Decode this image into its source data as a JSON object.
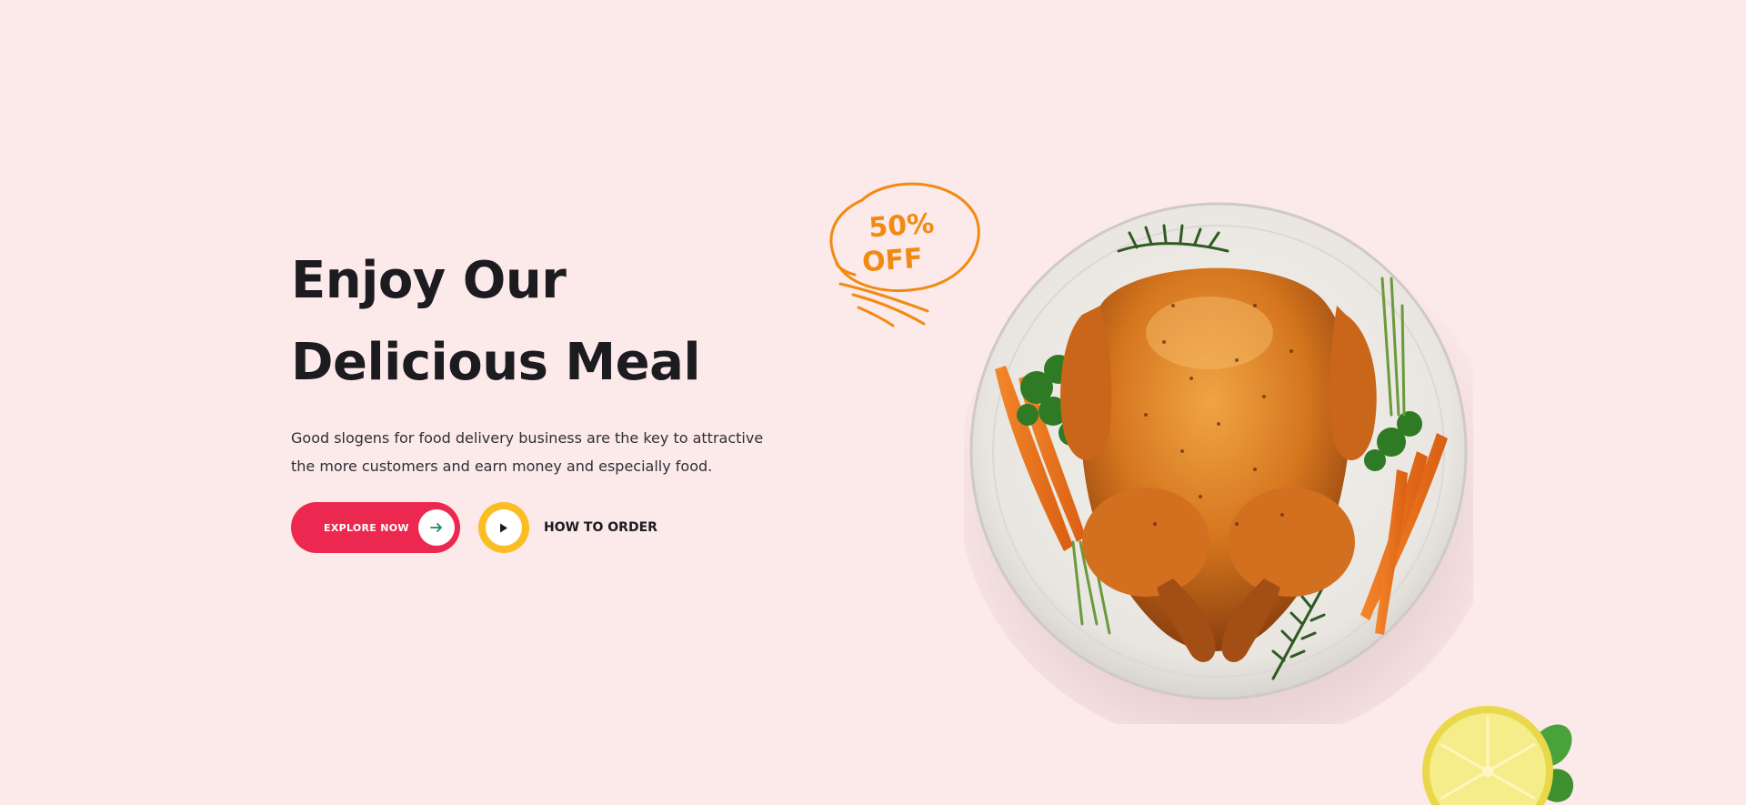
{
  "hero": {
    "headline_line1": "Enjoy Our",
    "headline_line2": "Delicious Meal",
    "description": "Good slogens for food delivery business are the key to attractive the more customers and earn money and especially food.",
    "explore_label": "EXPLORE NOW",
    "how_to_order_label": "HOW TO ORDER"
  },
  "badge": {
    "line1": "50%",
    "line2": "OFF"
  },
  "colors": {
    "background": "#fce9e9",
    "primary": "#ec2850",
    "accent_yellow": "#fbbd24",
    "badge_orange": "#f28a12",
    "text_dark": "#1b1b20"
  },
  "icons": {
    "explore_arrow": "arrow-right-icon",
    "play": "play-icon"
  }
}
